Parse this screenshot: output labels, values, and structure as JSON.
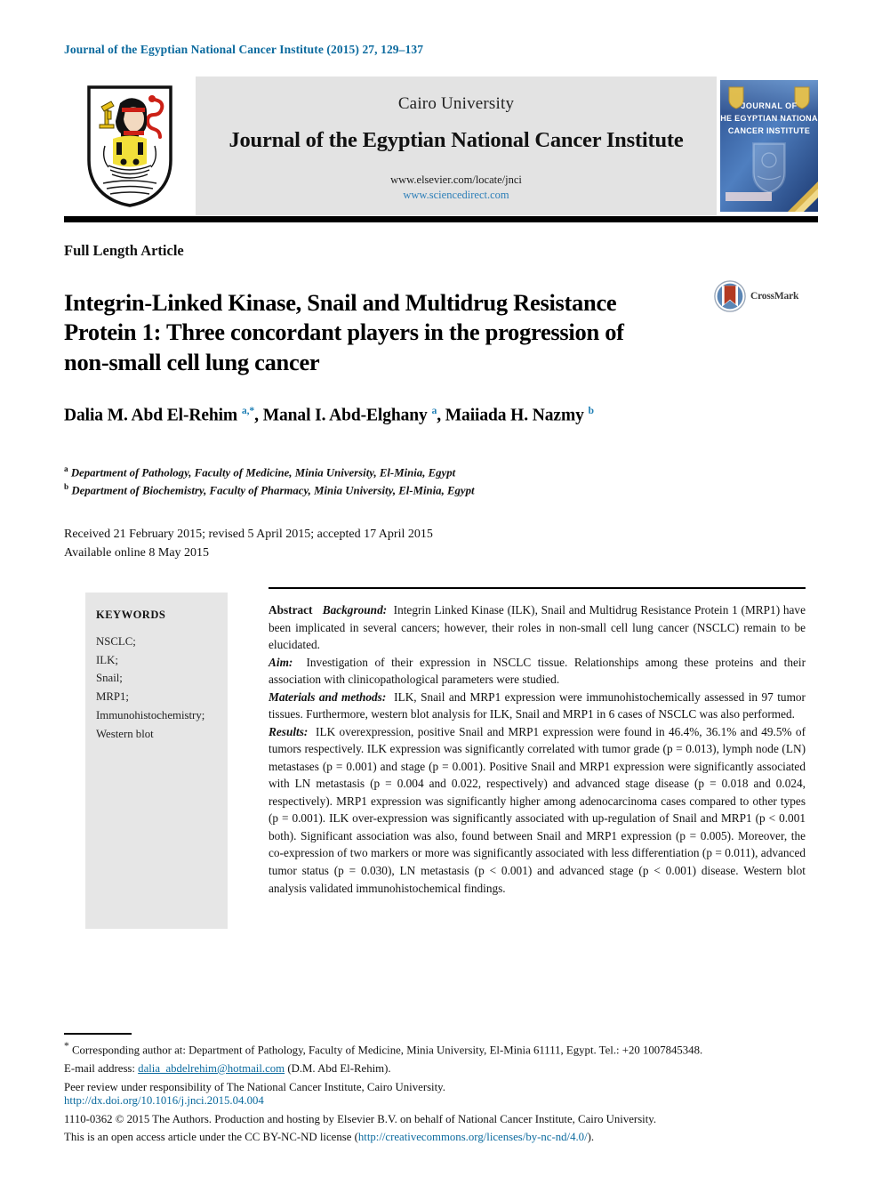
{
  "running_head": "Journal of the Egyptian National Cancer Institute (2015) 27, 129–137",
  "masthead": {
    "university": "Cairo University",
    "journal_title": "Journal of the Egyptian National Cancer Institute",
    "url_elsevier": "www.elsevier.com/locate/jnci",
    "url_sciencedirect": "www.sciencedirect.com",
    "crest_alt": "Cairo University crest",
    "cover_line1": "JOURNAL OF",
    "cover_line2": "THE EGYPTIAN NATIONAL",
    "cover_line3": "CANCER INSTITUTE"
  },
  "article": {
    "type": "Full Length Article",
    "title": "Integrin-Linked Kinase, Snail and Multidrug Resistance Protein 1: Three concordant players in the progression of non-small cell lung cancer",
    "crossmark_label": "CrossMark"
  },
  "authors": {
    "line_html": "Dalia M. Abd El-Rehim <sup>a,*</sup>, Manal I. Abd-Elghany <sup>a</sup>, Maiiada H. Nazmy <sup>b</sup>",
    "plain": "Dalia M. Abd El-Rehim a,*, Manal I. Abd-Elghany a, Maiiada H. Nazmy b"
  },
  "affiliations": [
    {
      "marker": "a",
      "text": "Department of Pathology, Faculty of Medicine, Minia University, El-Minia, Egypt"
    },
    {
      "marker": "b",
      "text": "Department of Biochemistry, Faculty of Pharmacy, Minia University, El-Minia, Egypt"
    }
  ],
  "dates": {
    "line1": "Received 21 February 2015; revised 5 April 2015; accepted 17 April 2015",
    "line2": "Available online 8 May 2015"
  },
  "keywords": {
    "heading": "KEYWORDS",
    "items": [
      "NSCLC;",
      "ILK;",
      "Snail;",
      "MRP1;",
      "Immunohistochemistry;",
      "Western blot"
    ]
  },
  "abstract": {
    "label": "Abstract",
    "sections": [
      {
        "heading": "Background:",
        "text": "Integrin Linked Kinase (ILK), Snail and Multidrug Resistance Protein 1 (MRP1) have been implicated in several cancers; however, their roles in non-small cell lung cancer (NSCLC) remain to be elucidated."
      },
      {
        "heading": "Aim:",
        "text": "Investigation of their expression in NSCLC tissue. Relationships among these proteins and their association with clinicopathological parameters were studied."
      },
      {
        "heading": "Materials and methods:",
        "text": "ILK, Snail and MRP1 expression were immunohistochemically assessed in 97 tumor tissues. Furthermore, western blot analysis for ILK, Snail and MRP1 in 6 cases of NSCLC was also performed."
      },
      {
        "heading": "Results:",
        "text": "ILK overexpression, positive Snail and MRP1 expression were found in 46.4%, 36.1% and 49.5% of tumors respectively. ILK expression was significantly correlated with tumor grade (p = 0.013), lymph node (LN) metastases (p = 0.001) and stage (p = 0.001). Positive Snail and MRP1 expression were significantly associated with LN metastasis (p = 0.004 and 0.022, respectively) and advanced stage disease (p = 0.018 and 0.024, respectively). MRP1 expression was significantly higher among adenocarcinoma cases compared to other types (p = 0.001). ILK over-expression was significantly associated with up-regulation of Snail and MRP1 (p < 0.001 both). Significant association was also, found between Snail and MRP1 expression (p = 0.005). Moreover, the co-expression of two markers or more was significantly associated with less differentiation (p = 0.011), advanced tumor status (p = 0.030), LN metastasis (p < 0.001) and advanced stage (p < 0.001) disease. Western blot analysis validated immunohistochemical findings."
      }
    ]
  },
  "footnotes": {
    "corresponding_prefix": "Corresponding author at: Department of Pathology, Faculty of Medicine, Minia University, El-Minia 61111, Egypt. Tel.: +20 1007845348.",
    "email_label": "E-mail address:",
    "email": "dalia_abdelrehim@hotmail.com",
    "email_suffix": "(D.M. Abd El-Rehim).",
    "peer_review": "Peer review under responsibility of The National Cancer Institute, Cairo University."
  },
  "license": {
    "doi": "http://dx.doi.org/10.1016/j.jnci.2015.04.004",
    "copyright": "1110-0362 © 2015 The Authors. Production and hosting by Elsevier B.V. on behalf of National Cancer Institute, Cairo University.",
    "open_access_prefix": "This is an open access article under the CC BY-NC-ND license (",
    "license_url": "http://creativecommons.org/licenses/by-nc-nd/4.0/",
    "open_access_suffix": ")."
  },
  "colors": {
    "accent_blue": "#0b6a9e",
    "link_blue": "#2d7fb8",
    "masthead_gray": "#e3e3e3",
    "keyword_gray": "#e6e6e6"
  }
}
